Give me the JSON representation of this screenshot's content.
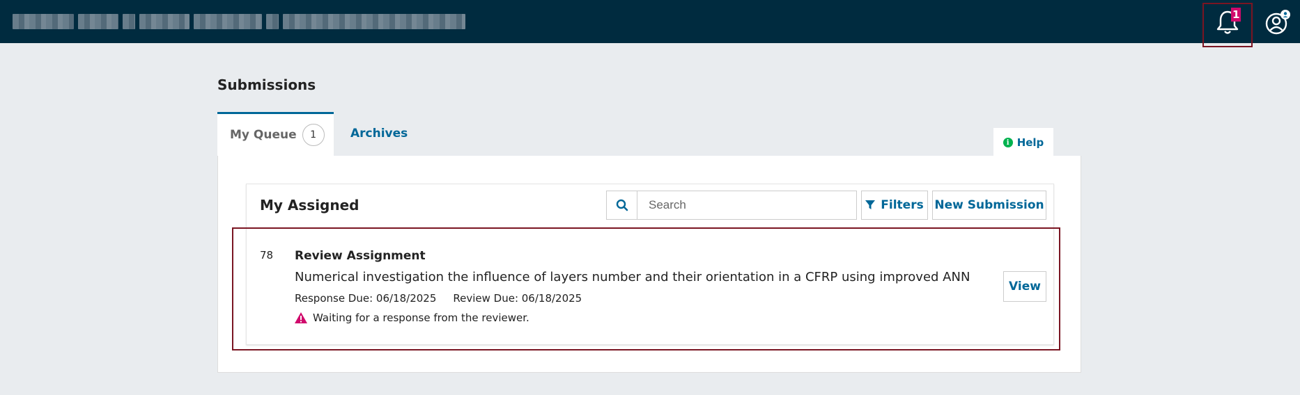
{
  "header": {
    "notifications": {
      "count": "1",
      "icon": "bell-icon"
    },
    "user_icon": "user-icon"
  },
  "page": {
    "title": "Submissions"
  },
  "tabs": [
    {
      "label": "My Queue",
      "count": "1"
    },
    {
      "label": "Archives"
    }
  ],
  "help": {
    "label": "Help",
    "icon": "info-icon"
  },
  "list": {
    "title": "My Assigned",
    "search": {
      "placeholder": "Search",
      "value": ""
    },
    "filters_label": "Filters",
    "new_submission_label": "New Submission",
    "items": [
      {
        "id": "78",
        "type": "Review Assignment",
        "title": "Numerical investigation the influence of layers number and their orientation in a CFRP using improved ANN",
        "response_due": "Response Due: 06/18/2025",
        "review_due": "Review Due: 06/18/2025",
        "status": "Waiting for a response from the reviewer.",
        "view_label": "View"
      }
    ]
  },
  "colors": {
    "header_bg": "#002b3f",
    "accent": "#006798",
    "badge": "#d00a6c",
    "warning": "#d00a6c",
    "highlight_border": "#7a1522",
    "help_icon": "#00b24e"
  }
}
